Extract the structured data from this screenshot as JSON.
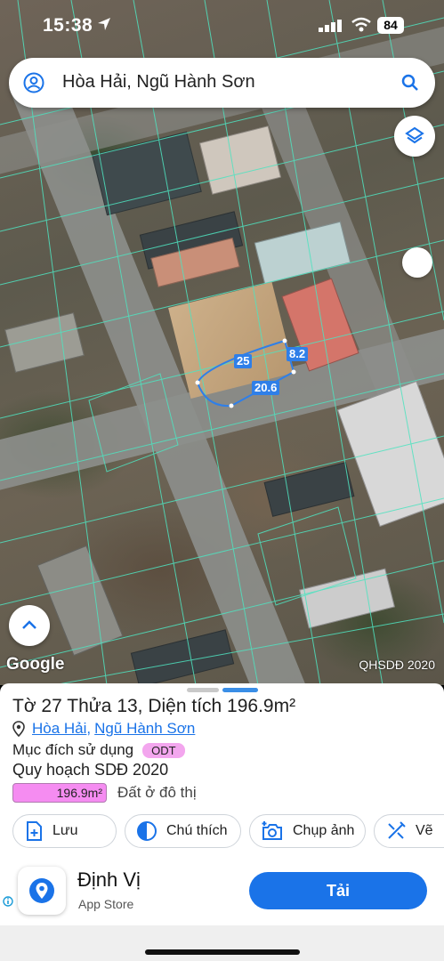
{
  "status_bar": {
    "time": "15:38",
    "battery": "84"
  },
  "search": {
    "query": "Hòa Hải, Ngũ Hành Sơn"
  },
  "map": {
    "attribution": "Google",
    "layer_label": "QHSDĐ 2020",
    "measurements": [
      "25",
      "8.2",
      "20.6"
    ]
  },
  "parcel": {
    "title": "Tờ 27 Thửa 13, Diện tích 196.9m²",
    "ward": "Hòa Hải",
    "district": "Ngũ Hành Sơn",
    "separator": ",",
    "use_label": "Mục đích sử dụng",
    "use_code": "ODT",
    "plan_title": "Quy hoạch SDĐ 2020",
    "plan_area": "196.9m²",
    "plan_desc": "Đất ở đô thị",
    "plan_color": "#f58cf1"
  },
  "actions": [
    "Lưu",
    "Chú thích",
    "Chụp ảnh",
    "Vẽ"
  ],
  "ad": {
    "app_name": "Định Vị",
    "store": "App Store",
    "button": "Tải",
    "accent": "#1a73e8"
  }
}
